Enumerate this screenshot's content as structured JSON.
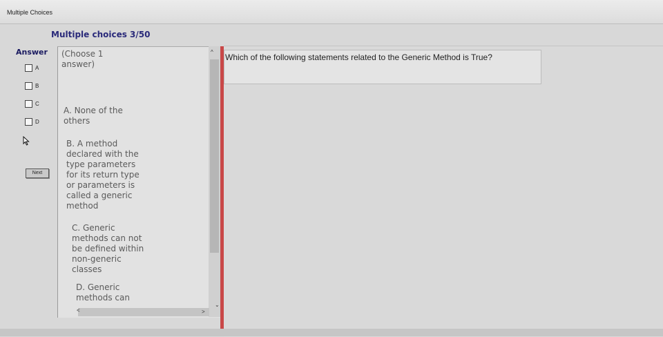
{
  "window": {
    "label": "Multiple Choices"
  },
  "header": {
    "section_title": "Multiple choices 3/50"
  },
  "answer": {
    "label": "Answer",
    "options": [
      "A",
      "B",
      "C",
      "D"
    ],
    "next_label": "Next"
  },
  "options_panel": {
    "instruction": "(Choose 1\nanswer)",
    "option_a": "A. None of the\nothers",
    "option_b": "B. A method\ndeclared with the\ntype parameters\nfor its return type\nor parameters is\ncalled a generic\nmethod",
    "option_c": "C. Generic\nmethods can not\nbe defined within\nnon-generic\nclasses",
    "option_d": "D. Generic\nmethods can"
  },
  "question": {
    "text": "Which of the following statements related to the Generic Method is True?"
  },
  "icons": [
    "checkbox-icon",
    "mouse-pointer-icon",
    "scroll-up-icon",
    "scroll-down-icon",
    "scroll-left-icon",
    "scroll-right-icon"
  ],
  "colors": {
    "accent_red": "#c94848",
    "title_blue": "#2a2a7a"
  }
}
